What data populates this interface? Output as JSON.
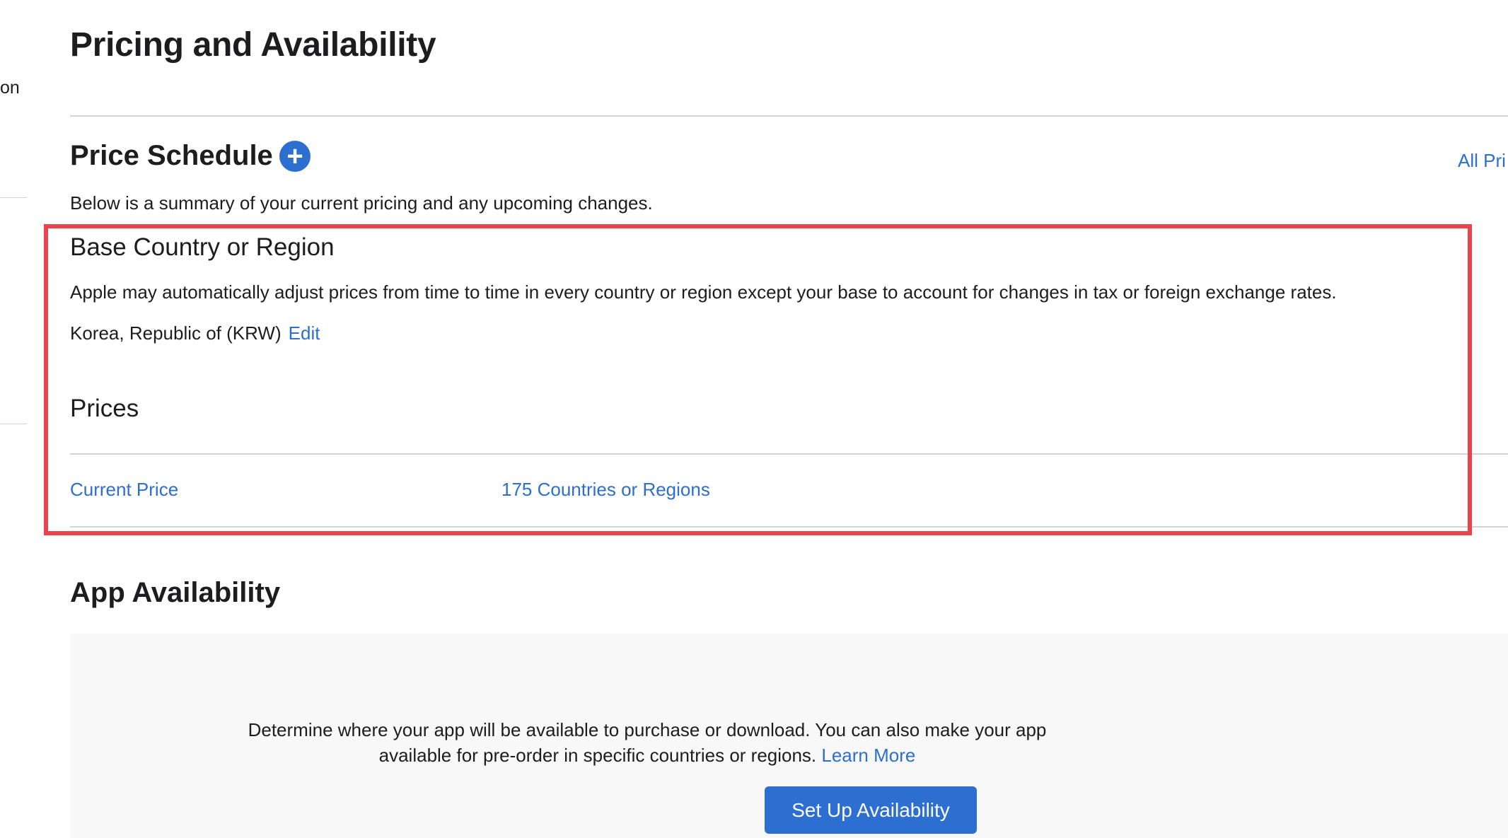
{
  "sidebar": {
    "fragment_text": "on"
  },
  "page": {
    "title": "Pricing and Availability"
  },
  "price_schedule": {
    "title": "Price Schedule",
    "add_icon": "+",
    "all_prices_link": "All Pri",
    "summary": "Below is a summary of your current pricing and any upcoming changes."
  },
  "base_country": {
    "title": "Base Country or Region",
    "description": "Apple may automatically adjust prices from time to time in every country or region except your base to account for changes in tax or foreign exchange rates.",
    "value": "Korea, Republic of (KRW)",
    "edit_label": "Edit"
  },
  "prices": {
    "title": "Prices",
    "columns": [
      "Current Price",
      "175 Countries or Regions"
    ]
  },
  "app_availability": {
    "title": "App Availability",
    "line1": "Determine where your app will be available to purchase or download. You can also make your app",
    "line2": "available for pre-order in specific countries or regions.",
    "learn_more": "Learn More",
    "button_label": "Set Up Availability"
  },
  "colors": {
    "accent": "#2c6fd1",
    "highlight": "#e8444a",
    "panel_bg": "#f8f8f9"
  },
  "icons": {
    "add": "plus-circle-icon"
  }
}
